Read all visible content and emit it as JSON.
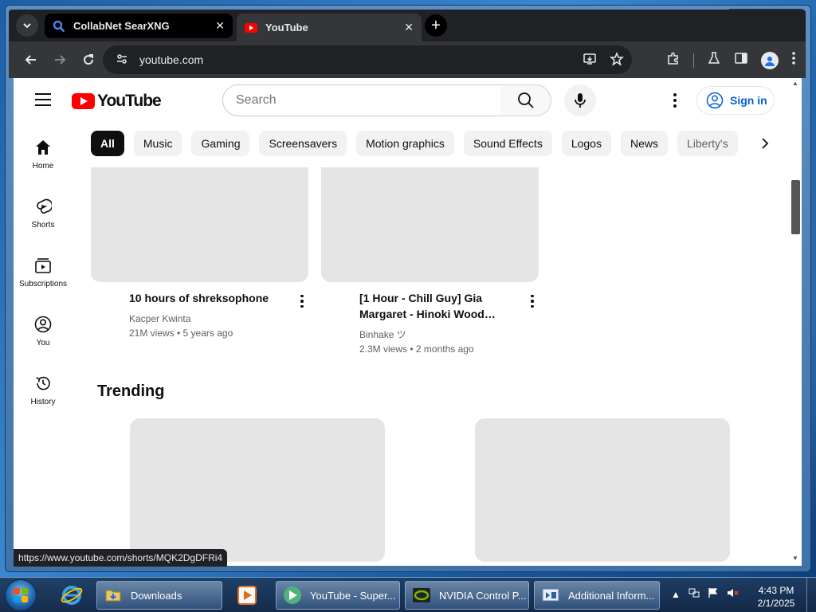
{
  "browser": {
    "tabs": [
      {
        "title": "CollabNet SearXNG",
        "close": "✕"
      },
      {
        "title": "YouTube",
        "close": "✕"
      }
    ],
    "new_tab": "+",
    "address": "youtube.com",
    "status_url": "https://www.youtube.com/shorts/MQK2DgDFRi4"
  },
  "youtube": {
    "logo_text": "YouTube",
    "search_placeholder": "Search",
    "sign_in": "Sign in",
    "chips": [
      "All",
      "Music",
      "Gaming",
      "Screensavers",
      "Motion graphics",
      "Sound Effects",
      "Logos",
      "News",
      "Liberty's"
    ],
    "guide": [
      {
        "label": "Home",
        "icon": "home-icon"
      },
      {
        "label": "Shorts",
        "icon": "shorts-icon"
      },
      {
        "label": "Subscriptions",
        "icon": "subscriptions-icon"
      },
      {
        "label": "You",
        "icon": "you-icon"
      },
      {
        "label": "History",
        "icon": "history-icon"
      }
    ],
    "videos": [
      {
        "title": "10 hours of shreksophone",
        "title2": "",
        "channel": "Kacper Kwinta",
        "meta": "21M views • 5 years ago"
      },
      {
        "title": "[1 Hour - Chill Guy] Gia",
        "title2": "Margaret - Hinoki Wood…",
        "channel": "Binhake ツ",
        "meta": "2.3M views • 2 months ago"
      }
    ],
    "section_title": "Trending"
  },
  "taskbar": {
    "items": [
      {
        "label": "Downloads"
      },
      {
        "label": "YouTube - Super..."
      },
      {
        "label": "NVIDIA Control P..."
      },
      {
        "label": "Additional Inform..."
      }
    ],
    "time": "4:43 PM",
    "date": "2/1/2025"
  },
  "colors": {
    "youtube_red": "#ff0000",
    "link_blue": "#065fd4",
    "chrome_dark": "#202124"
  }
}
